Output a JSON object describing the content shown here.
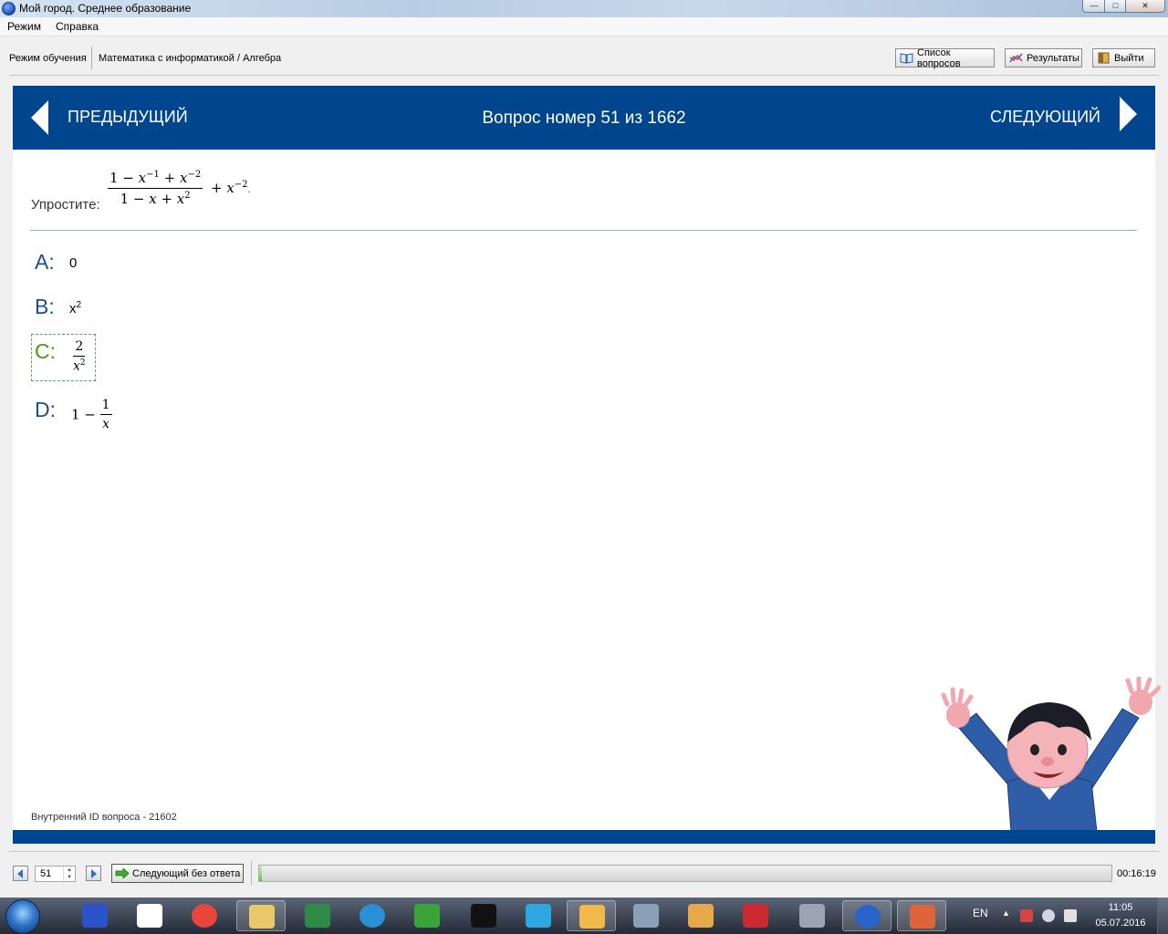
{
  "window": {
    "title": "Мой город. Среднее образование",
    "min": "0",
    "max": "1",
    "close": "r"
  },
  "menu": {
    "items": [
      "Режим",
      "Справка"
    ]
  },
  "toolbar": {
    "mode": "Режим обучения",
    "subject": "Математика с информатикой / Алгебра",
    "question_list": "Список вопросов",
    "results": "Результаты",
    "exit": "Выйти"
  },
  "nav": {
    "prev": "ПРЕДЫДУЩИЙ",
    "next": "СЛЕДУЮЩИЙ",
    "title": "Вопрос номер 51 из 1662"
  },
  "question": {
    "label": "Упростите:",
    "formula": {
      "num": [
        "1 − ",
        "x",
        "−1",
        " + ",
        "x",
        "−2"
      ],
      "den": [
        "1 − ",
        "x",
        " + ",
        "x",
        "2"
      ],
      "tail": [
        "+ ",
        "x",
        "−2",
        "."
      ]
    }
  },
  "answers": [
    {
      "letter": "A:",
      "text": "0"
    },
    {
      "letter": "B:",
      "text": "x",
      "sup": "2"
    },
    {
      "letter": "C:",
      "num": "2",
      "den": "x",
      "den_sup": "2",
      "selected": true
    },
    {
      "letter": "D:",
      "lead": "1 − ",
      "num": "1",
      "den": "x"
    }
  ],
  "internal_id": "Внутренний ID вопроса - 21602",
  "bottom": {
    "question_number": "51",
    "skip": "Следующий без ответа",
    "progress_fraction": 0.003,
    "timer": "00:16:19"
  },
  "taskbar": {
    "lang": "EN",
    "time": "11:05",
    "date": "05.07.2016",
    "apps": [
      "save-app",
      "d-app",
      "chrome",
      "explorer",
      "monitor",
      "globe",
      "utorrent",
      "cmd",
      "telegram",
      "winamp",
      "camera",
      "paint",
      "book",
      "calculator",
      "moy-gorod",
      "volume"
    ]
  },
  "colors": {
    "nav_blue": "#00468e",
    "letter_blue": "#1c4f88",
    "selected_green": "#4a9a14"
  }
}
